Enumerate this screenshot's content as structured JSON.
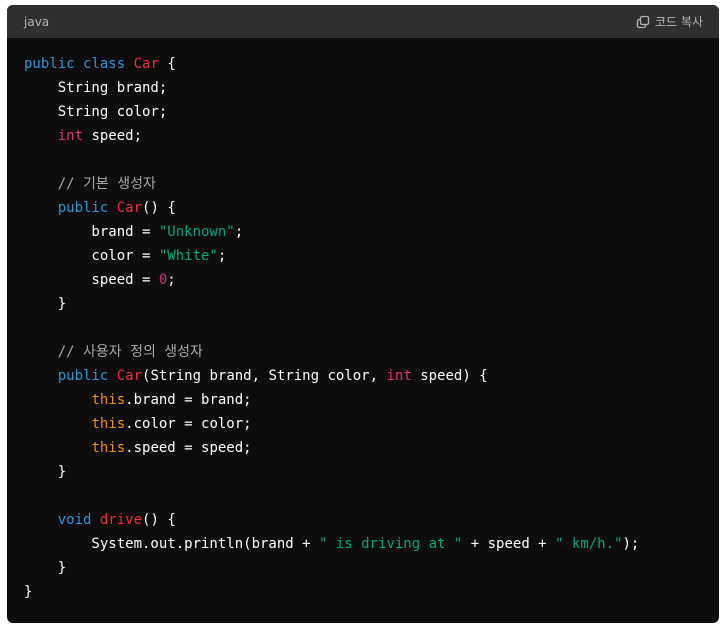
{
  "header": {
    "language": "java",
    "copy_label": "코드 복사",
    "copy_icon": "copy-icon"
  },
  "colors": {
    "background": "#0d0d0d",
    "header_bg": "#2f2f2f",
    "keyword": "#2e95d3",
    "type_keyword": "#df3079",
    "class_name": "#f22c3d",
    "string": "#00a67d",
    "comment": "#a7a7a7",
    "this_keyword": "#e9950c"
  },
  "code": {
    "lines": [
      [
        {
          "t": "kw-blue",
          "s": "public"
        },
        {
          "t": "plain",
          "s": " "
        },
        {
          "t": "kw-blue",
          "s": "class"
        },
        {
          "t": "plain",
          "s": " "
        },
        {
          "t": "cls-red",
          "s": "Car"
        },
        {
          "t": "plain",
          "s": " {"
        }
      ],
      [
        {
          "t": "plain",
          "s": "    String brand;"
        }
      ],
      [
        {
          "t": "plain",
          "s": "    String color;"
        }
      ],
      [
        {
          "t": "plain",
          "s": "    "
        },
        {
          "t": "kw-red",
          "s": "int"
        },
        {
          "t": "plain",
          "s": " speed;"
        }
      ],
      [],
      [
        {
          "t": "plain",
          "s": "    "
        },
        {
          "t": "comment",
          "s": "// 기본 생성자"
        }
      ],
      [
        {
          "t": "plain",
          "s": "    "
        },
        {
          "t": "kw-blue",
          "s": "public"
        },
        {
          "t": "plain",
          "s": " "
        },
        {
          "t": "cls-red",
          "s": "Car"
        },
        {
          "t": "plain",
          "s": "() {"
        }
      ],
      [
        {
          "t": "plain",
          "s": "        brand = "
        },
        {
          "t": "str-green",
          "s": "\"Unknown\""
        },
        {
          "t": "plain",
          "s": ";"
        }
      ],
      [
        {
          "t": "plain",
          "s": "        color = "
        },
        {
          "t": "str-green",
          "s": "\"White\""
        },
        {
          "t": "plain",
          "s": ";"
        }
      ],
      [
        {
          "t": "plain",
          "s": "        speed = "
        },
        {
          "t": "kw-red",
          "s": "0"
        },
        {
          "t": "plain",
          "s": ";"
        }
      ],
      [
        {
          "t": "plain",
          "s": "    }"
        }
      ],
      [],
      [
        {
          "t": "plain",
          "s": "    "
        },
        {
          "t": "comment",
          "s": "// 사용자 정의 생성자"
        }
      ],
      [
        {
          "t": "plain",
          "s": "    "
        },
        {
          "t": "kw-blue",
          "s": "public"
        },
        {
          "t": "plain",
          "s": " "
        },
        {
          "t": "cls-red",
          "s": "Car"
        },
        {
          "t": "plain",
          "s": "(String brand, String color, "
        },
        {
          "t": "kw-red",
          "s": "int"
        },
        {
          "t": "plain",
          "s": " speed) {"
        }
      ],
      [
        {
          "t": "plain",
          "s": "        "
        },
        {
          "t": "this-kw",
          "s": "this"
        },
        {
          "t": "plain",
          "s": ".brand = brand;"
        }
      ],
      [
        {
          "t": "plain",
          "s": "        "
        },
        {
          "t": "this-kw",
          "s": "this"
        },
        {
          "t": "plain",
          "s": ".color = color;"
        }
      ],
      [
        {
          "t": "plain",
          "s": "        "
        },
        {
          "t": "this-kw",
          "s": "this"
        },
        {
          "t": "plain",
          "s": ".speed = speed;"
        }
      ],
      [
        {
          "t": "plain",
          "s": "    }"
        }
      ],
      [],
      [
        {
          "t": "plain",
          "s": "    "
        },
        {
          "t": "kw-blue",
          "s": "void"
        },
        {
          "t": "plain",
          "s": " "
        },
        {
          "t": "cls-red",
          "s": "drive"
        },
        {
          "t": "plain",
          "s": "() {"
        }
      ],
      [
        {
          "t": "plain",
          "s": "        System.out.println(brand + "
        },
        {
          "t": "str-green",
          "s": "\" is driving at \""
        },
        {
          "t": "plain",
          "s": " + speed + "
        },
        {
          "t": "str-green",
          "s": "\" km/h.\""
        },
        {
          "t": "plain",
          "s": ");"
        }
      ],
      [
        {
          "t": "plain",
          "s": "    }"
        }
      ],
      [
        {
          "t": "plain",
          "s": "}"
        }
      ]
    ]
  }
}
